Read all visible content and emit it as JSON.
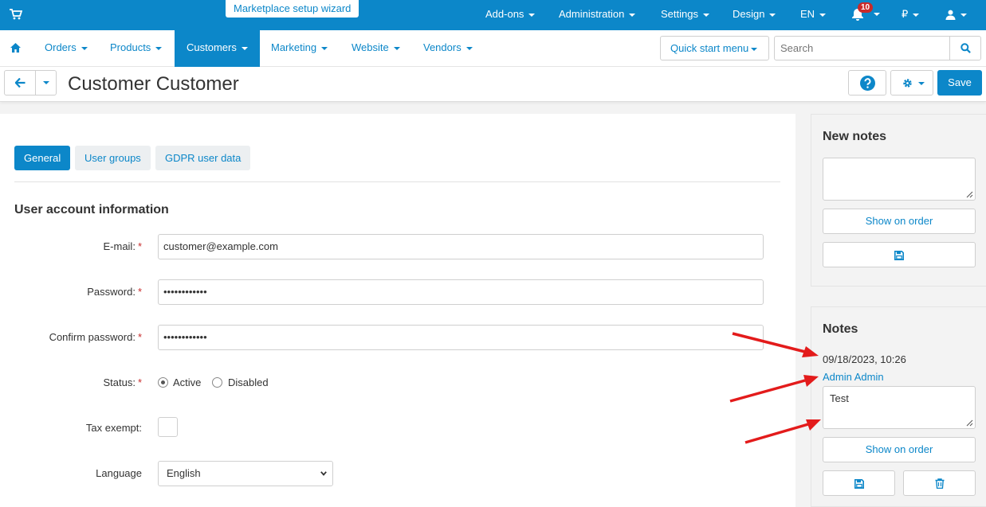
{
  "topbar": {
    "wizard_label": "Marketplace setup wizard",
    "menus": [
      "Add-ons",
      "Administration",
      "Settings",
      "Design",
      "EN"
    ],
    "notifications_count": "10",
    "currency": "₽"
  },
  "nav": {
    "items": [
      "Orders",
      "Products",
      "Customers",
      "Marketing",
      "Website",
      "Vendors"
    ],
    "active": "Customers",
    "quick_start": "Quick start menu",
    "search_placeholder": "Search"
  },
  "header": {
    "title": "Customer Customer",
    "save_label": "Save"
  },
  "tabs": [
    "General",
    "User groups",
    "GDPR user data"
  ],
  "form": {
    "section_title": "User account information",
    "email_label": "E-mail:",
    "email_value": "customer@example.com",
    "password_label": "Password:",
    "password_value": "••••••••••••",
    "confirm_label": "Confirm password:",
    "confirm_value": "••••••••••••",
    "status_label": "Status:",
    "status_active": "Active",
    "status_disabled": "Disabled",
    "status_selected": "Active",
    "tax_label": "Tax exempt:",
    "language_label": "Language",
    "language_value": "English",
    "required_mark": "*"
  },
  "new_notes": {
    "title": "New notes",
    "show_on_order": "Show on order"
  },
  "notes": {
    "title": "Notes",
    "date": "09/18/2023, 10:26",
    "author": "Admin Admin",
    "text": "Test",
    "show_on_order": "Show on order"
  },
  "colors": {
    "primary": "#0c87c9",
    "annotation_arrow": "#e31b1b"
  }
}
